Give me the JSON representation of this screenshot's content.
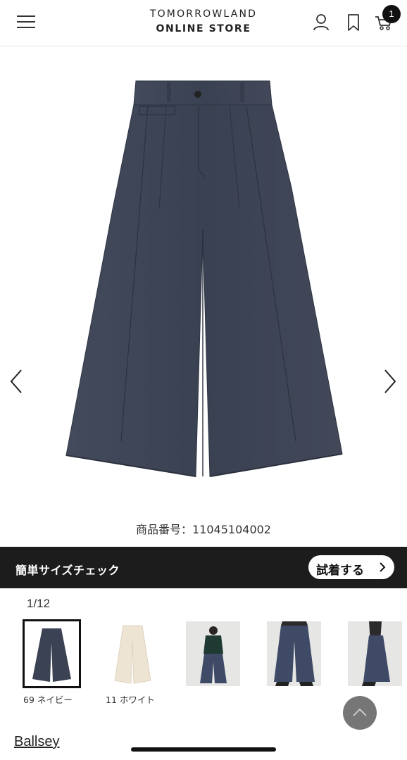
{
  "header": {
    "logo_line1": "TOMORROWLAND",
    "logo_line2": "ONLINE STORE",
    "cart_count": "1",
    "icons": [
      "menu-icon",
      "user-icon",
      "bookmark-icon",
      "cart-icon"
    ]
  },
  "product": {
    "number_label": "商品番号：11045104002",
    "image_counter": "1/12"
  },
  "size_check": {
    "title": "簡単サイズチェック",
    "button_label": "試着する"
  },
  "thumbnails": [
    {
      "label": "69 ネイビー",
      "kind": "navy-pants"
    },
    {
      "label": "11 ホワイト",
      "kind": "white-pants"
    },
    {
      "label": "",
      "kind": "model-front"
    },
    {
      "label": "",
      "kind": "model-closeup"
    },
    {
      "label": "",
      "kind": "model-side"
    }
  ],
  "brand": {
    "name": "Ballsey"
  },
  "colors": {
    "navy": "#3b4253",
    "bar": "#1c1c1c",
    "badge": "#111111",
    "cream": "#ede4d3"
  }
}
